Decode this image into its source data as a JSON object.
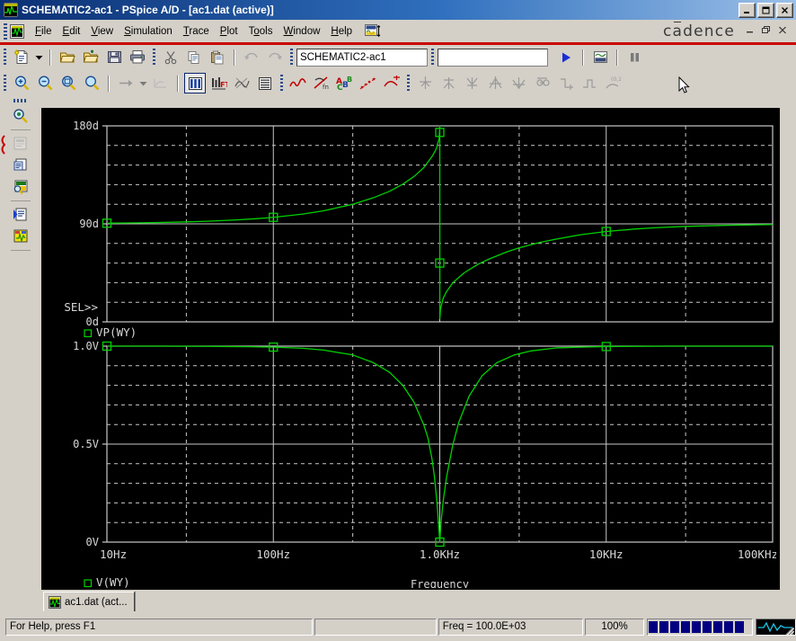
{
  "window": {
    "title": "SCHEMATIC2-ac1 - PSpice A/D  - [ac1.dat (active)]",
    "app_icon": "pspice-icon",
    "controls": {
      "minimize": "_",
      "maximize": "❐",
      "close": "✕"
    }
  },
  "menu": {
    "items": [
      {
        "label": "File",
        "accel": "F"
      },
      {
        "label": "Edit",
        "accel": "E"
      },
      {
        "label": "View",
        "accel": "V"
      },
      {
        "label": "Simulation",
        "accel": "S"
      },
      {
        "label": "Trace",
        "accel": "T"
      },
      {
        "label": "Plot",
        "accel": "P"
      },
      {
        "label": "Tools",
        "accel": "o"
      },
      {
        "label": "Window",
        "accel": "W"
      },
      {
        "label": "Help",
        "accel": "H"
      }
    ],
    "trailing_icon": "probe-window-icon"
  },
  "branding": {
    "logo_text": "cadence",
    "mdi_minimize": "—",
    "mdi_restore": "❐",
    "mdi_close": "✕"
  },
  "toolbar_main": {
    "buttons": [
      {
        "name": "new-document-button",
        "icon": "new-file-icon"
      },
      {
        "name": "new-document-dropdown",
        "icon": "chevron-down-icon"
      },
      {
        "name": "open-button",
        "icon": "open-folder-icon"
      },
      {
        "name": "open-simulation-button",
        "icon": "open-folder-plus-icon"
      },
      {
        "name": "save-button",
        "icon": "floppy-save-icon"
      },
      {
        "name": "print-button",
        "icon": "printer-icon"
      },
      {
        "name": "cut-button",
        "icon": "scissors-icon"
      },
      {
        "name": "copy-button",
        "icon": "copy-icon"
      },
      {
        "name": "paste-button",
        "icon": "paste-icon"
      },
      {
        "name": "undo-button",
        "icon": "undo-arrow-icon"
      },
      {
        "name": "redo-button",
        "icon": "redo-arrow-icon"
      }
    ],
    "profile_field": {
      "value": "SCHEMATIC2-ac1",
      "placeholder": ""
    },
    "second_field": {
      "value": "",
      "placeholder": ""
    },
    "run_button": {
      "name": "run-simulation-button",
      "icon": "play-triangle-icon"
    },
    "view_sim_results_button": {
      "name": "view-results-button",
      "icon": "results-window-icon"
    },
    "pause_button": {
      "name": "pause-simulation-button",
      "icon": "pause-bars-icon"
    }
  },
  "toolbar_plot": {
    "buttons": [
      {
        "name": "zoom-in-button",
        "icon": "zoom-in-icon"
      },
      {
        "name": "zoom-out-button",
        "icon": "zoom-out-icon"
      },
      {
        "name": "zoom-area-button",
        "icon": "zoom-area-icon"
      },
      {
        "name": "zoom-fit-button",
        "icon": "zoom-fit-icon"
      },
      {
        "name": "step-forward-button",
        "icon": "right-arrow-icon"
      },
      {
        "name": "step-dropdown",
        "icon": "chevron-down-icon"
      },
      {
        "name": "trace-end-button",
        "icon": "trace-end-icon"
      },
      {
        "name": "toggle-cursor-button",
        "icon": "columns-icon"
      },
      {
        "name": "fourier-button",
        "icon": "fft-icon"
      },
      {
        "name": "performance-analysis-button",
        "icon": "performance-icon"
      },
      {
        "name": "log-commands-button",
        "icon": "list-lines-icon"
      },
      {
        "name": "add-trace-button",
        "icon": "waveform-red-icon"
      },
      {
        "name": "eval-goal-button",
        "icon": "goal-function-icon"
      },
      {
        "name": "abc-button",
        "icon": "abc-label-icon"
      },
      {
        "name": "scatter-trace-button",
        "icon": "scatter-dots-icon"
      },
      {
        "name": "cursor-peak-button",
        "icon": "cursor-curve-icon"
      },
      {
        "name": "cursor-toggle-button",
        "icon": "cursor-cross-icon"
      },
      {
        "name": "cursor-peak2-button",
        "icon": "cursor-peak-icon"
      },
      {
        "name": "cursor-trough-button",
        "icon": "cursor-trough-icon"
      },
      {
        "name": "cursor-slope-button",
        "icon": "cursor-slope-icon"
      },
      {
        "name": "cursor-min-button",
        "icon": "cursor-min-icon"
      },
      {
        "name": "cursor-max-button",
        "icon": "cursor-max-icon"
      },
      {
        "name": "cursor-next-button",
        "icon": "cursor-next-icon"
      },
      {
        "name": "cursor-prev-button",
        "icon": "cursor-prev-icon"
      },
      {
        "name": "mark-label-button",
        "icon": "mark-point-icon"
      }
    ]
  },
  "toolbar_left": {
    "buttons": [
      {
        "name": "probe-zoom-button",
        "icon": "magnifier-chip-icon"
      },
      {
        "name": "netlist-button",
        "icon": "netlist-disabled-icon"
      },
      {
        "name": "output-file-button",
        "icon": "output-file-icon"
      },
      {
        "name": "simulation-output-button",
        "icon": "sim-output-icon"
      },
      {
        "name": "probe-window-button",
        "icon": "probe-blue-icon"
      },
      {
        "name": "schematic-button",
        "icon": "schematic-icon"
      }
    ]
  },
  "document_tab": {
    "label": "ac1.dat (act...",
    "icon": "waveform-doc-icon"
  },
  "statusbar": {
    "help_text": "For Help, press F1",
    "blank_pane": "",
    "freq_text": "Freq =  100.0E+03",
    "zoom_text": "100%",
    "progress_blocks": 9,
    "wave_icon": "waveform-status-icon"
  },
  "chart_data": [
    {
      "type": "line",
      "name": "phase-plot",
      "title": "",
      "xlabel": "",
      "ylabel": "",
      "xscale": "log",
      "xlim": [
        10,
        100000
      ],
      "ylim": [
        0,
        180
      ],
      "xticks": [
        10,
        100,
        1000,
        10000,
        100000
      ],
      "xticklabels": [
        "10Hz",
        "100Hz",
        "1.0KHz",
        "10KHz",
        "100KHz"
      ],
      "yticks": [
        0,
        90,
        180
      ],
      "yticklabels": [
        "0d",
        "90d",
        "180d"
      ],
      "grid": true,
      "selected_marker": "SEL>>",
      "legend": [
        {
          "label": "VP(WY)",
          "color": "#00d000",
          "marker": "square"
        }
      ],
      "series": [
        {
          "name": "VP(WY)",
          "color": "#00d000",
          "x": [
            10,
            14,
            20,
            30,
            40,
            60,
            80,
            100,
            150,
            200,
            300,
            400,
            500,
            600,
            700,
            800,
            900,
            950,
            990,
            999,
            1000,
            1001,
            1010,
            1050,
            1100,
            1200,
            1400,
            1700,
            2000,
            2500,
            3000,
            4000,
            5000,
            7000,
            10000,
            15000,
            20000,
            30000,
            50000,
            70000,
            100000
          ],
          "y": [
            90.6,
            90.8,
            91.2,
            91.8,
            92.4,
            93.6,
            94.8,
            96.0,
            99.0,
            102.0,
            108.0,
            114.0,
            120.0,
            126.5,
            133.5,
            141.5,
            152.0,
            158.5,
            168.0,
            177.0,
            180.0,
            3.0,
            12.0,
            22.0,
            28.0,
            36.0,
            45.0,
            53.0,
            58.0,
            64.0,
            68.0,
            73.0,
            76.0,
            80.0,
            83.0,
            85.3,
            86.5,
            87.7,
            88.6,
            89.0,
            89.4
          ],
          "data_markers": [
            {
              "x": 10,
              "y": 90.6
            },
            {
              "x": 100,
              "y": 96.0
            },
            {
              "x": 1000,
              "y": 174.0
            },
            {
              "x": 1000,
              "y": 54.0
            },
            {
              "x": 10000,
              "y": 83.0
            }
          ]
        }
      ]
    },
    {
      "type": "line",
      "name": "magnitude-plot",
      "title": "",
      "xlabel": "Frequency",
      "ylabel": "",
      "xscale": "log",
      "xlim": [
        10,
        100000
      ],
      "ylim": [
        0,
        1.0
      ],
      "xticks": [
        10,
        100,
        1000,
        10000,
        100000
      ],
      "xticklabels": [
        "10Hz",
        "100Hz",
        "1.0KHz",
        "10KHz",
        "100KHz"
      ],
      "yticks": [
        0,
        0.5,
        1.0
      ],
      "yticklabels": [
        "0V",
        "0.5V",
        "1.0V"
      ],
      "grid": true,
      "legend": [
        {
          "label": "V(WY)",
          "color": "#00d000",
          "marker": "square"
        }
      ],
      "series": [
        {
          "name": "V(WY)",
          "color": "#00d000",
          "x": [
            10,
            20,
            40,
            70,
            100,
            150,
            200,
            300,
            400,
            500,
            600,
            700,
            800,
            850,
            900,
            930,
            960,
            980,
            990,
            1000,
            1010,
            1020,
            1050,
            1100,
            1200,
            1300,
            1500,
            1800,
            2200,
            2800,
            3500,
            5000,
            7000,
            10000,
            15000,
            25000,
            50000,
            100000
          ],
          "y": [
            1.0,
            1.0,
            0.999,
            0.997,
            0.995,
            0.989,
            0.98,
            0.955,
            0.915,
            0.866,
            0.8,
            0.714,
            0.6,
            0.53,
            0.42,
            0.33,
            0.21,
            0.11,
            0.055,
            0.0,
            0.055,
            0.11,
            0.215,
            0.335,
            0.5,
            0.61,
            0.745,
            0.85,
            0.915,
            0.955,
            0.975,
            0.991,
            0.995,
            0.998,
            0.999,
            1.0,
            1.0,
            1.0
          ],
          "data_markers": [
            {
              "x": 10,
              "y": 1.0
            },
            {
              "x": 100,
              "y": 0.995
            },
            {
              "x": 1000,
              "y": 0.0
            },
            {
              "x": 10000,
              "y": 0.998
            }
          ]
        }
      ]
    }
  ]
}
